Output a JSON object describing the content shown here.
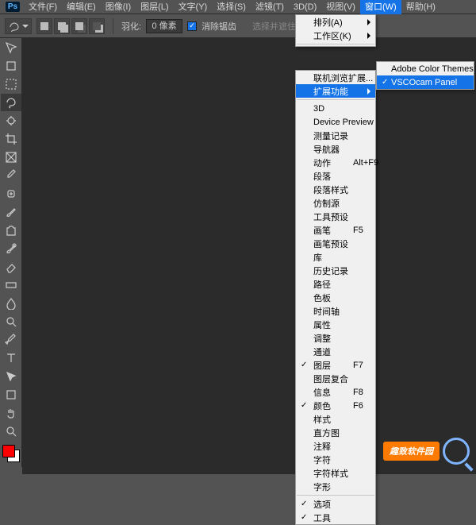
{
  "logo_text": "Ps",
  "menubar": [
    {
      "label": "文件(F)"
    },
    {
      "label": "编辑(E)"
    },
    {
      "label": "图像(I)"
    },
    {
      "label": "图层(L)"
    },
    {
      "label": "文字(Y)"
    },
    {
      "label": "选择(S)"
    },
    {
      "label": "滤镜(T)"
    },
    {
      "label": "3D(D)"
    },
    {
      "label": "视图(V)"
    },
    {
      "label": "窗口(W)",
      "open": true
    },
    {
      "label": "帮助(H)"
    }
  ],
  "optbar": {
    "feather_label": "羽化:",
    "feather_value": "0 像素",
    "aa_label": "消除锯齿",
    "hint": "选择并遮住…"
  },
  "tools": [
    "move",
    "artboard",
    "marquee",
    "lasso",
    "quick-select",
    "crop",
    "frame",
    "eyedropper",
    "healing",
    "brush",
    "clone",
    "history-brush",
    "eraser",
    "gradient",
    "blur",
    "dodge",
    "pen",
    "type",
    "path-select",
    "rectangle",
    "hand",
    "zoom"
  ],
  "window_menu_top": [
    {
      "label": "排列(A)",
      "sub": true
    },
    {
      "label": "工作区(K)",
      "sub": true
    }
  ],
  "window_menu": [
    {
      "label": "联机浏览扩展..."
    },
    {
      "label": "扩展功能",
      "sub": true,
      "hi": true
    },
    {
      "sep": true
    },
    {
      "label": "3D"
    },
    {
      "label": "Device Preview"
    },
    {
      "label": "测量记录"
    },
    {
      "label": "导航器"
    },
    {
      "label": "动作",
      "shortcut": "Alt+F9"
    },
    {
      "label": "段落"
    },
    {
      "label": "段落样式"
    },
    {
      "label": "仿制源"
    },
    {
      "label": "工具预设"
    },
    {
      "label": "画笔",
      "shortcut": "F5"
    },
    {
      "label": "画笔预设"
    },
    {
      "label": "库"
    },
    {
      "label": "历史记录"
    },
    {
      "label": "路径"
    },
    {
      "label": "色板"
    },
    {
      "label": "时间轴"
    },
    {
      "label": "属性"
    },
    {
      "label": "调整"
    },
    {
      "label": "通道"
    },
    {
      "label": "图层",
      "shortcut": "F7",
      "checked": true
    },
    {
      "label": "图层复合"
    },
    {
      "label": "信息",
      "shortcut": "F8"
    },
    {
      "label": "颜色",
      "shortcut": "F6",
      "checked": true
    },
    {
      "label": "样式"
    },
    {
      "label": "直方图"
    },
    {
      "label": "注释"
    },
    {
      "label": "字符"
    },
    {
      "label": "字符样式"
    },
    {
      "label": "字形"
    },
    {
      "sep": true
    },
    {
      "label": "选项",
      "checked": true
    },
    {
      "label": "工具",
      "checked": true
    }
  ],
  "ext_menu": [
    {
      "label": "Adobe Color Themes"
    },
    {
      "label": "VSCOcam Panel",
      "hi": true,
      "checked": true
    }
  ],
  "watermark": "趣致软件园"
}
